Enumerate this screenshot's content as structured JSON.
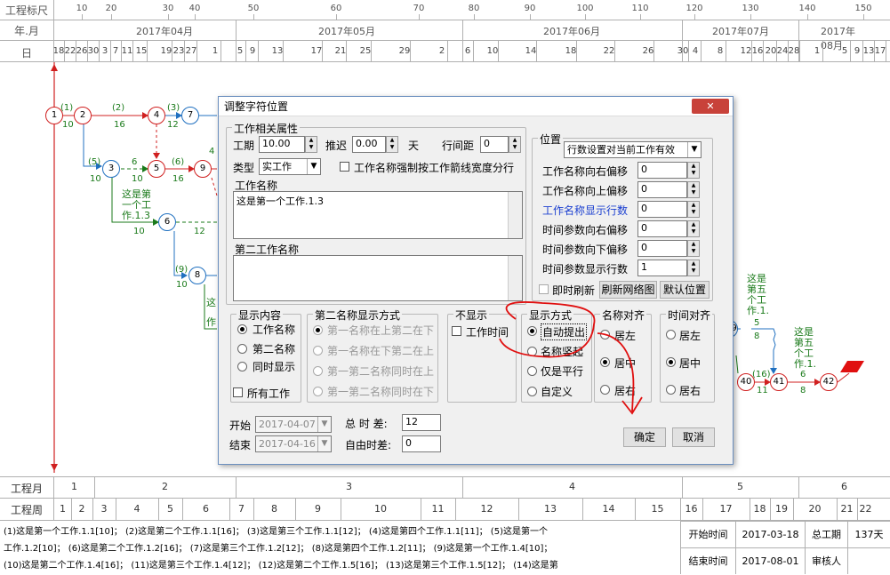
{
  "header": {
    "scale_label": "工程标尺",
    "ym_label": "年.月",
    "day_label": "日",
    "scale_ticks": [
      "10",
      "20",
      "30",
      "40",
      "50",
      "60",
      "70",
      "80",
      "90",
      "100",
      "110",
      "120",
      "130",
      "140",
      "150"
    ],
    "months": [
      "2017年04月",
      "2017年05月",
      "2017年06月",
      "2017年07月",
      "2017年08月"
    ],
    "days": [
      "18",
      "22",
      "26",
      "30",
      "3",
      "7",
      "11",
      "15",
      "19",
      "23",
      "27",
      "1",
      "5",
      "9",
      "13",
      "17",
      "21",
      "25",
      "29",
      "2",
      "6",
      "10",
      "14",
      "18",
      "22",
      "26",
      "30",
      "4",
      "8",
      "12",
      "16",
      "20",
      "24",
      "28",
      "1",
      "5",
      "9",
      "13",
      "17"
    ]
  },
  "network": {
    "nodes": [
      "1",
      "2",
      "3",
      "4",
      "5",
      "6",
      "7",
      "8",
      "9",
      "39",
      "40",
      "41",
      "42"
    ],
    "labels": {
      "a1": "(1)",
      "d1": "10",
      "a2": "(2)",
      "d2": "16",
      "a3": "(3)",
      "d3": "12",
      "a5": "(5)",
      "d5": "10",
      "a6": "(6)",
      "d6": "16",
      "a9": "(9)",
      "d9": "10",
      "d4": "4",
      "d12": "12",
      "d6b": "6",
      "d10": "10",
      "w1": "这是第一个工作.1.3",
      "w2": "这",
      "w3": "作",
      "right_a": "这是第五个工作.1.",
      "right_b": "这是第五个工作.1.",
      "r5": "5",
      "r8": "8",
      "a16": "(16)",
      "d11": "11",
      "r6": "6",
      "r8b": "8"
    }
  },
  "dialog": {
    "title": "调整字符位置",
    "close": "✕",
    "work_props": "工作相关属性",
    "duration_label": "工期",
    "duration_value": "10.00",
    "delay_label": "推迟",
    "delay_value": "0.00",
    "day_unit": "天",
    "rowgap_label": "行间距",
    "rowgap_value": "0",
    "type_label": "类型",
    "type_value": "实工作",
    "force_wrap": "工作名称强制按工作箭线宽度分行",
    "name_label": "工作名称",
    "name_value": "这是第一个工作.1.3",
    "second_name_label": "第二工作名称",
    "second_name_value": "",
    "position": "位置",
    "pos_select": "行数设置对当前工作有效",
    "pos_fields": [
      {
        "label": "工作名称向右偏移",
        "value": "0"
      },
      {
        "label": "工作名称向上偏移",
        "value": "0"
      },
      {
        "label": "工作名称显示行数",
        "value": "0"
      },
      {
        "label": "时间参数向右偏移",
        "value": "0"
      },
      {
        "label": "时间参数向下偏移",
        "value": "0"
      },
      {
        "label": "时间参数显示行数",
        "value": "1"
      }
    ],
    "instant_refresh": "即时刷新",
    "refresh_btn": "刷新网络图",
    "default_pos_btn": "默认位置",
    "display_content": "显示内容",
    "dc_opts": [
      "工作名称",
      "第二名称",
      "同时显示"
    ],
    "all_work": "所有工作",
    "second_display": "第二名称显示方式",
    "sd_opts": [
      "第一名称在上第二在下",
      "第一名称在下第二在上",
      "第一第二名称同时在上",
      "第一第二名称同时在下"
    ],
    "no_display": "不显示",
    "work_time": "工作时间",
    "display_mode": "显示方式",
    "dm_opts": [
      "自动提出",
      "名称竖起",
      "仅是平行",
      "自定义"
    ],
    "name_align": "名称对齐",
    "na_opts": [
      "居左",
      "居中",
      "居右"
    ],
    "time_align": "时间对齐",
    "ta_opts": [
      "居左",
      "居中",
      "居右"
    ],
    "start_label": "开始",
    "start_value": "2017-04-07",
    "end_label": "结束",
    "end_value": "2017-04-16",
    "total_float_label": "总 时 差:",
    "total_float_value": "12",
    "free_float_label": "自由时差:",
    "free_float_value": "0",
    "ok": "确定",
    "cancel": "取消"
  },
  "bottom": {
    "month_label": "工程月",
    "week_label": "工程周",
    "months": [
      "1",
      "2",
      "3",
      "4",
      "5",
      "6"
    ],
    "weeks": [
      "1",
      "2",
      "3",
      "4",
      "5",
      "6",
      "7",
      "8",
      "9",
      "10",
      "11",
      "12",
      "13",
      "14",
      "15",
      "16",
      "17",
      "18",
      "19",
      "20",
      "21",
      "22"
    ],
    "legend": [
      "(1)这是第一个工作.1.1[10]；  (2)这是第二个工作.1.1[16]；  (3)这是第三个工作.1.1[12]；  (4)这是第四个工作.1.1[11]；  (5)这是第一个",
      "工作.1.2[10]；  (6)这是第二个工作.1.2[16]；  (7)这是第三个工作.1.2[12]；  (8)这是第四个工作.1.2[11]；  (9)这是第一个工作.1.4[10]；",
      "(10)这是第二个工作.1.4[16]；  (11)这是第三个工作.1.4[12]；  (12)这是第二个工作.1.5[16]；  (13)这是第三个工作.1.5[12]；  (14)这是第"
    ],
    "start_time_label": "开始时间",
    "start_time": "2017-03-18",
    "total_dur_label": "总工期",
    "total_dur": "137天",
    "end_time_label": "结束时间",
    "end_time": "2017-08-01",
    "reviewer_label": "审核人"
  }
}
